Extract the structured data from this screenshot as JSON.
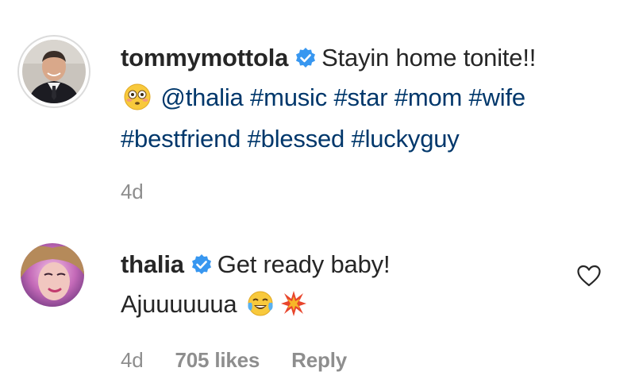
{
  "caption": {
    "username": "tommymottola",
    "text_line1": "Stayin home tonite!!",
    "mention": "@thalia",
    "hashtags_line2": [
      "#music",
      "#star",
      "#mom",
      "#wife"
    ],
    "hashtags_line3": [
      "#bestfriend",
      "#blessed",
      "#luckyguy"
    ],
    "time": "4d"
  },
  "reply": {
    "username": "thalia",
    "text_line1": "Get ready baby!",
    "text_line2": "Ajuuuuuua",
    "time": "4d",
    "likes": "705 likes",
    "reply_label": "Reply"
  },
  "icons": {
    "verified_color": "#3897f0",
    "flushed_emoji": "flushed-face",
    "laughing_emoji": "face-with-tears-of-joy",
    "collision_emoji": "collision",
    "heart": "heart-outline"
  },
  "colors": {
    "text": "#262626",
    "link": "#00376b",
    "muted": "#8e8e8e"
  }
}
